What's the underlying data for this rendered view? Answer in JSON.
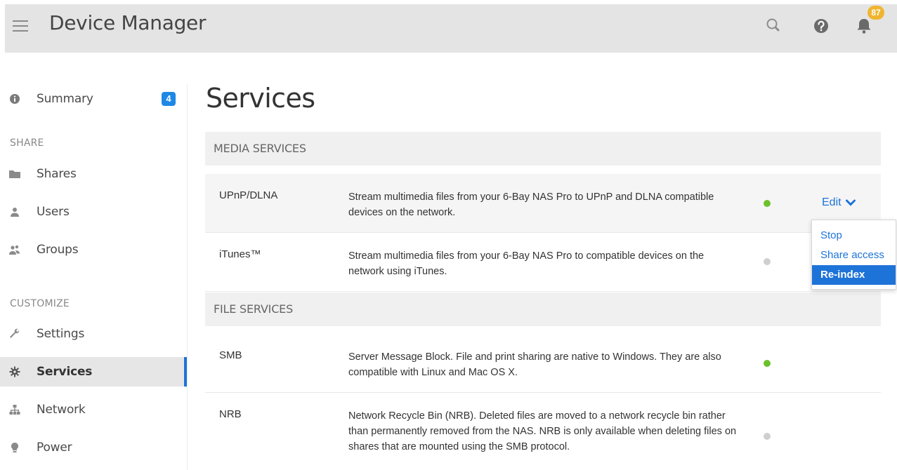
{
  "header": {
    "title": "Device Manager",
    "notification_count": "87"
  },
  "sidebar": {
    "summary": {
      "label": "Summary",
      "badge": "4"
    },
    "share_section": "SHARE",
    "share_items": [
      {
        "label": "Shares",
        "icon": "folder-icon"
      },
      {
        "label": "Users",
        "icon": "user-icon"
      },
      {
        "label": "Groups",
        "icon": "group-icon"
      }
    ],
    "customize_section": "CUSTOMIZE",
    "customize_items": [
      {
        "label": "Settings",
        "icon": "wrench-icon"
      },
      {
        "label": "Services",
        "icon": "gear-icon",
        "active": true
      },
      {
        "label": "Network",
        "icon": "network-icon"
      },
      {
        "label": "Power",
        "icon": "bulb-icon"
      }
    ]
  },
  "main": {
    "title": "Services",
    "media_section": "MEDIA SERVICES",
    "file_section": "FILE SERVICES",
    "media_services": [
      {
        "name": "UPnP/DLNA",
        "description": "Stream multimedia files from your 6-Bay NAS Pro to UPnP and DLNA compatible devices on the network.",
        "status": "on"
      },
      {
        "name": "iTunes™",
        "description": "Stream multimedia files from your 6-Bay NAS Pro to compatible devices on the network using iTunes.",
        "status": "off"
      }
    ],
    "file_services": [
      {
        "name": "SMB",
        "description": "Server Message Block. File and print sharing are native to Windows. They are also compatible with Linux and Mac OS X.",
        "status": "on"
      },
      {
        "name": "NRB",
        "description": "Network Recycle Bin (NRB). Deleted files are moved to a network recycle bin rather than permanently removed from the NAS. NRB is only available when deleting files on shares that are mounted using the SMB protocol.",
        "status": "off"
      }
    ],
    "edit_label": "Edit",
    "dropdown": [
      "Stop",
      "Share access",
      "Re-index"
    ],
    "dropdown_selected": "Re-index"
  },
  "colors": {
    "accent": "#1e73d8",
    "status_on": "#6cc12a",
    "status_off": "#cfcfcf",
    "badge": "#f0b530"
  }
}
